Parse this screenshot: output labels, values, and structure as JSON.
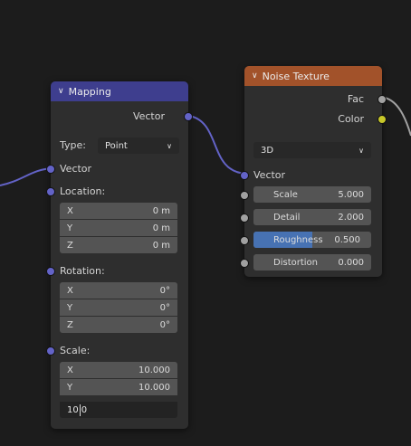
{
  "colors": {
    "mapping_header": "#3e3e8e",
    "noise_header": "#a2522a",
    "vector_socket": "#6363c7",
    "float_socket": "#a1a1a1",
    "color_socket": "#c7c729",
    "slider_fill": "#4772b3"
  },
  "mapping": {
    "title": "Mapping",
    "output_vector": "Vector",
    "type_label": "Type:",
    "type_value": "Point",
    "input_vector": "Vector",
    "location": {
      "label": "Location:",
      "rows": [
        {
          "axis": "X",
          "value": "0 m"
        },
        {
          "axis": "Y",
          "value": "0 m"
        },
        {
          "axis": "Z",
          "value": "0 m"
        }
      ]
    },
    "rotation": {
      "label": "Rotation:",
      "rows": [
        {
          "axis": "X",
          "value": "0°"
        },
        {
          "axis": "Y",
          "value": "0°"
        },
        {
          "axis": "Z",
          "value": "0°"
        }
      ]
    },
    "scale": {
      "label": "Scale:",
      "rows": [
        {
          "axis": "X",
          "value": "10.000"
        },
        {
          "axis": "Y",
          "value": "10.000"
        }
      ],
      "editing_before_cursor": "10",
      "editing_after_cursor": "0"
    }
  },
  "noise": {
    "title": "Noise Texture",
    "out_fac": "Fac",
    "out_color": "Color",
    "dimensions": "3D",
    "input_vector": "Vector",
    "fields": [
      {
        "label": "Scale",
        "value": "5.000"
      },
      {
        "label": "Detail",
        "value": "2.000"
      },
      {
        "label": "Roughness",
        "value": "0.500",
        "fill_fraction": 0.5
      },
      {
        "label": "Distortion",
        "value": "0.000"
      }
    ]
  }
}
